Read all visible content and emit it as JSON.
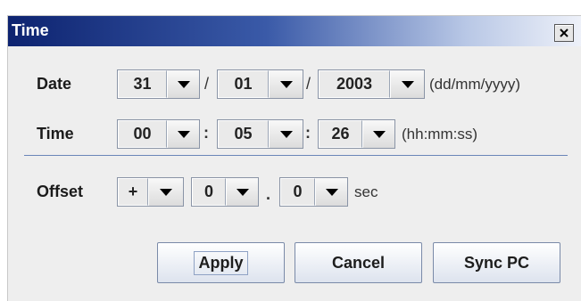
{
  "window": {
    "title": "Time"
  },
  "labels": {
    "date": "Date",
    "time": "Time",
    "offset": "Offset"
  },
  "date": {
    "day": "31",
    "month": "01",
    "year": "2003",
    "sep": "/",
    "format_hint": "(dd/mm/yyyy)"
  },
  "time": {
    "hours": "00",
    "minutes": "05",
    "seconds": "26",
    "sep": ":",
    "format_hint": "(hh:mm:ss)"
  },
  "offset": {
    "sign": "+",
    "whole": "0",
    "fraction": "0",
    "sep": ".",
    "unit": "sec"
  },
  "buttons": {
    "apply": "Apply",
    "cancel": "Cancel",
    "sync": "Sync PC"
  },
  "icons": {
    "close": "close-icon",
    "dropdown": "chevron-down-icon"
  }
}
